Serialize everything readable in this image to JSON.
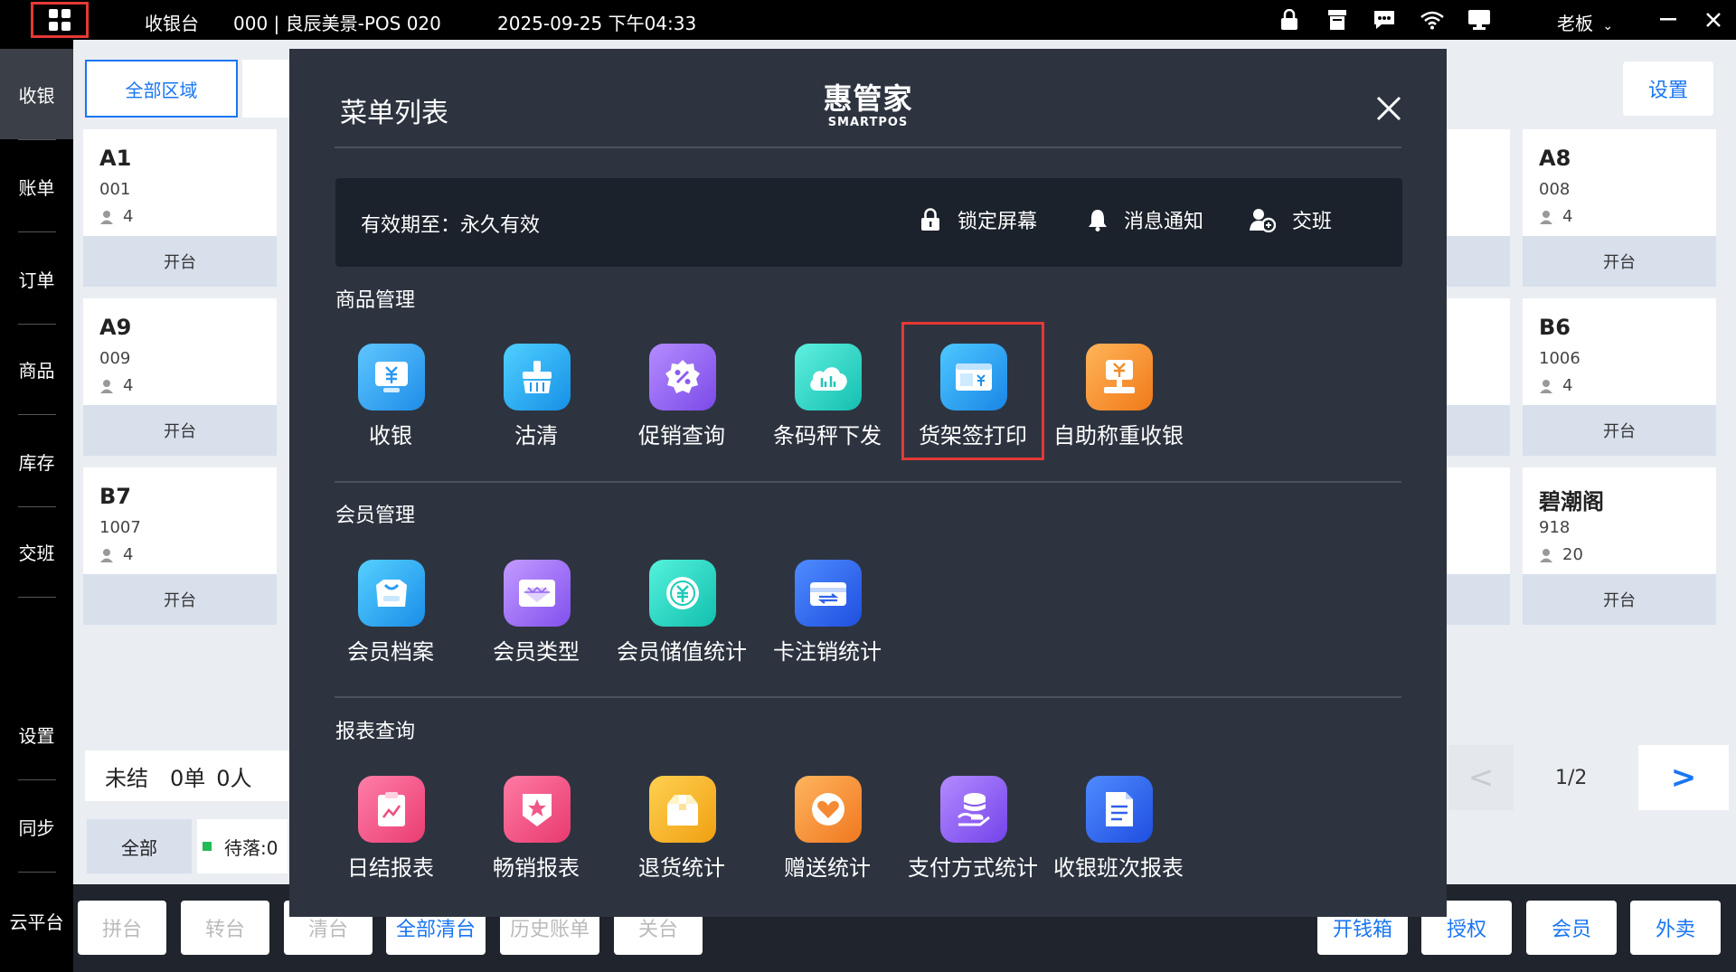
{
  "topbar": {
    "app_name": "收银台",
    "store_info": "000 | 良辰美景-POS 020",
    "datetime": "2025-09-25 下午04:33",
    "user": "老板",
    "icons": [
      "lock-icon",
      "receipt-icon",
      "chat-icon",
      "wifi-icon",
      "monitor-icon",
      "minimize-icon",
      "close-icon"
    ]
  },
  "leftnav": {
    "items": [
      {
        "label": "收银"
      },
      {
        "label": "账单"
      },
      {
        "label": "订单"
      },
      {
        "label": "商品"
      },
      {
        "label": "库存"
      },
      {
        "label": "交班"
      },
      {
        "label": "设置"
      },
      {
        "label": "同步"
      },
      {
        "label": "云平台"
      }
    ]
  },
  "floor": {
    "area_tab": "全部区域",
    "settings": "设置",
    "open_label": "开台",
    "tables": [
      {
        "name": "A1",
        "code": "001",
        "guests": "4"
      },
      {
        "name": "A9",
        "code": "009",
        "guests": "4"
      },
      {
        "name": "B7",
        "code": "1007",
        "guests": "4"
      },
      {
        "name": "A8",
        "code": "008",
        "guests": "4"
      },
      {
        "name": "B6",
        "code": "1006",
        "guests": "4"
      },
      {
        "name": "碧潮阁",
        "code": "918",
        "guests": "20"
      }
    ],
    "summary": {
      "label": "未结",
      "orders": "0单",
      "people": "0人"
    },
    "filter_all": "全部",
    "filter_wait": "待落:0",
    "pager": {
      "prev": "<",
      "text": "1/2",
      "next": ">"
    }
  },
  "bottombar": {
    "left": [
      "拼台",
      "转台",
      "清台",
      "全部清台",
      "历史账单",
      "关台"
    ],
    "right": [
      "开钱箱",
      "授权",
      "会员",
      "外卖"
    ]
  },
  "modal": {
    "title": "菜单列表",
    "brand_main": "惠管家",
    "brand_sub": "SMARTPOS",
    "validity": "有效期至：永久有效",
    "lock_screen": "锁定屏幕",
    "notifications": "消息通知",
    "shift": "交班",
    "sections": [
      {
        "title": "商品管理",
        "items": [
          {
            "label": "收银",
            "icon": "cashier-icon"
          },
          {
            "label": "沽清",
            "icon": "broom-icon"
          },
          {
            "label": "促销查询",
            "icon": "promotion-icon"
          },
          {
            "label": "条码秤下发",
            "icon": "cloud-scale-icon"
          },
          {
            "label": "货架签打印",
            "icon": "shelf-label-icon"
          },
          {
            "label": "自助称重收银",
            "icon": "self-weigh-icon"
          }
        ]
      },
      {
        "title": "会员管理",
        "items": [
          {
            "label": "会员档案",
            "icon": "member-profile-icon"
          },
          {
            "label": "会员类型",
            "icon": "member-type-icon"
          },
          {
            "label": "会员储值统计",
            "icon": "stored-value-icon"
          },
          {
            "label": "卡注销统计",
            "icon": "card-cancel-icon"
          }
        ]
      },
      {
        "title": "报表查询",
        "items": [
          {
            "label": "日结报表",
            "icon": "daily-report-icon"
          },
          {
            "label": "畅销报表",
            "icon": "bestseller-icon"
          },
          {
            "label": "退货统计",
            "icon": "return-icon"
          },
          {
            "label": "赠送统计",
            "icon": "gift-icon"
          },
          {
            "label": "支付方式统计",
            "icon": "payment-icon"
          },
          {
            "label": "收银班次报表",
            "icon": "shift-report-icon"
          }
        ]
      }
    ]
  },
  "colors": {
    "accent": "#1976f2",
    "modal_bg": "#2d3440",
    "highlight": "#e53935"
  }
}
